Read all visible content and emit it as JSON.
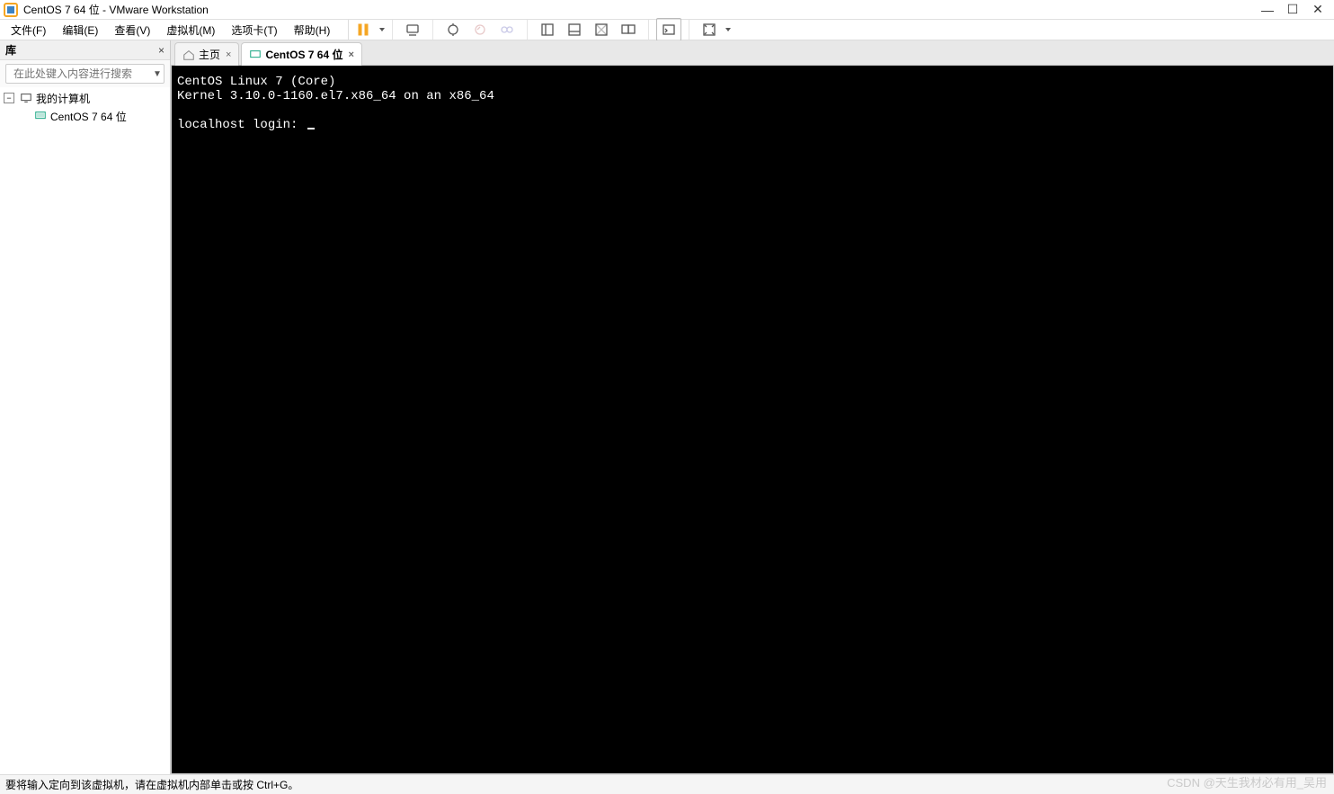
{
  "window": {
    "title": "CentOS 7 64 位 - VMware Workstation"
  },
  "menu": {
    "file": "文件(F)",
    "edit": "编辑(E)",
    "view": "查看(V)",
    "vm": "虚拟机(M)",
    "tabs": "选项卡(T)",
    "help": "帮助(H)"
  },
  "sidebar": {
    "title": "库",
    "search_placeholder": "在此处键入内容进行搜索",
    "root": "我的计算机",
    "items": [
      {
        "label": "CentOS 7 64 位"
      }
    ]
  },
  "tabs": {
    "home": "主页",
    "vm": "CentOS 7 64 位"
  },
  "console": {
    "line1": "CentOS Linux 7 (Core)",
    "line2": "Kernel 3.10.0-1160.el7.x86_64 on an x86_64",
    "prompt": "localhost login: "
  },
  "status": {
    "text": "要将输入定向到该虚拟机，请在虚拟机内部单击或按 Ctrl+G。"
  },
  "watermark": "CSDN @天生我材必有用_吴用"
}
